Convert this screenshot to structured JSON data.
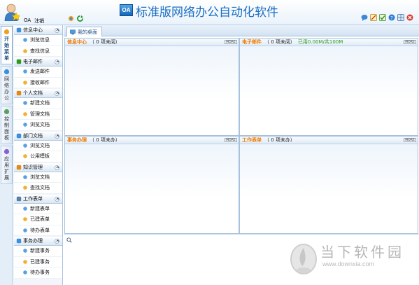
{
  "header": {
    "user_name": "OA",
    "logout_label": "注销",
    "logo_text": "OA",
    "app_title": "标准版网络办公自动化软件"
  },
  "vtabs": [
    {
      "label": [
        "开",
        "始",
        "菜",
        "单"
      ],
      "active": true
    },
    {
      "label": [
        "网",
        "络",
        "办",
        "公"
      ],
      "active": false
    },
    {
      "label": [
        "控",
        "制",
        "面",
        "板"
      ],
      "active": false
    },
    {
      "label": [
        "应",
        "用",
        "扩",
        "展"
      ],
      "active": false
    }
  ],
  "sidebar": {
    "groups": [
      {
        "title": "信息中心",
        "items": [
          "浏览信息",
          "查找信息"
        ]
      },
      {
        "title": "电子邮件",
        "items": [
          "发送邮件",
          "接收邮件"
        ]
      },
      {
        "title": "个人文档",
        "items": [
          "新建文档",
          "管理文档",
          "浏览文档"
        ]
      },
      {
        "title": "部门文档",
        "items": [
          "浏览文档",
          "公用模板"
        ]
      },
      {
        "title": "知识管理",
        "items": [
          "浏览文档",
          "查找文档"
        ]
      },
      {
        "title": "工作表单",
        "items": [
          "新建表单",
          "已建表单",
          "待办表单"
        ]
      },
      {
        "title": "事务办理",
        "items": [
          "新建事务",
          "已建事务",
          "待办事务"
        ]
      }
    ]
  },
  "main": {
    "tab_label": "我的桌面",
    "more_label": "MORE",
    "panels": [
      {
        "title": "信息中心",
        "sub": "（ 0 项未阅）",
        "extra": ""
      },
      {
        "title": "电子邮件",
        "sub": "（ 0 项未阅）",
        "extra": "已用0.00M/共100M"
      },
      {
        "title": "事务办理",
        "sub": "（ 0 项未办）",
        "extra": ""
      },
      {
        "title": "工作表单",
        "sub": "（ 0 项未办）",
        "extra": ""
      }
    ]
  },
  "watermark": {
    "text": "当下软件园",
    "url": "www.downxia.com"
  }
}
